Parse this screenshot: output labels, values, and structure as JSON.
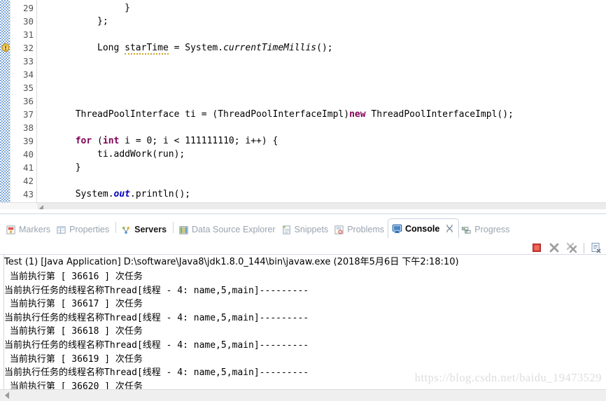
{
  "editor": {
    "name": "java-code-editor",
    "marker_icon": "warning-icon",
    "marker_line": 32,
    "lines": [
      {
        "no": "29",
        "indent": 16,
        "tokens": [
          {
            "t": "}",
            "c": "plain"
          }
        ]
      },
      {
        "no": "30",
        "indent": 11,
        "tokens": [
          {
            "t": "};",
            "c": "plain"
          }
        ]
      },
      {
        "no": "31",
        "indent": 0,
        "tokens": []
      },
      {
        "no": "32",
        "indent": 11,
        "tokens": [
          {
            "t": "Long ",
            "c": "plain"
          },
          {
            "t": "starTime",
            "c": "warn"
          },
          {
            "t": " = System.",
            "c": "plain"
          },
          {
            "t": "currentTimeMillis",
            "c": "method"
          },
          {
            "t": "();",
            "c": "plain"
          }
        ]
      },
      {
        "no": "33",
        "indent": 0,
        "tokens": []
      },
      {
        "no": "34",
        "indent": 0,
        "tokens": []
      },
      {
        "no": "35",
        "indent": 0,
        "tokens": []
      },
      {
        "no": "36",
        "indent": 0,
        "tokens": []
      },
      {
        "no": "37",
        "indent": 7,
        "tokens": [
          {
            "t": "ThreadPoolInterface ti = (ThreadPoolInterfaceImpl)",
            "c": "plain"
          },
          {
            "t": "new",
            "c": "keyword"
          },
          {
            "t": " ThreadPoolInterfaceImpl();",
            "c": "plain"
          }
        ]
      },
      {
        "no": "38",
        "indent": 0,
        "tokens": []
      },
      {
        "no": "39",
        "indent": 7,
        "tokens": [
          {
            "t": "for",
            "c": "keyword"
          },
          {
            "t": " (",
            "c": "plain"
          },
          {
            "t": "int",
            "c": "keyword"
          },
          {
            "t": " i = 0; i < 111111110; i++) {",
            "c": "plain"
          }
        ]
      },
      {
        "no": "40",
        "indent": 11,
        "tokens": [
          {
            "t": "ti.addWork(run);",
            "c": "plain"
          }
        ]
      },
      {
        "no": "41",
        "indent": 7,
        "tokens": [
          {
            "t": "}",
            "c": "plain"
          }
        ]
      },
      {
        "no": "42",
        "indent": 0,
        "tokens": []
      },
      {
        "no": "43",
        "indent": 7,
        "tokens": [
          {
            "t": "System.",
            "c": "plain"
          },
          {
            "t": "out",
            "c": "field"
          },
          {
            "t": ".println();",
            "c": "plain"
          }
        ]
      }
    ]
  },
  "view_tabs": [
    {
      "label": "Markers",
      "icon": "markers-icon",
      "state": "inactive"
    },
    {
      "label": "Properties",
      "icon": "properties-icon",
      "state": "inactive"
    },
    {
      "label": "Servers",
      "icon": "servers-icon",
      "state": "selected-bold"
    },
    {
      "label": "Data Source Explorer",
      "icon": "data-source-explorer-icon",
      "state": "inactive"
    },
    {
      "label": "Snippets",
      "icon": "snippets-icon",
      "state": "inactive"
    },
    {
      "label": "Problems",
      "icon": "problems-icon",
      "state": "inactive"
    },
    {
      "label": "Console",
      "icon": "console-icon",
      "state": "active",
      "closable": true
    },
    {
      "label": "Progress",
      "icon": "progress-icon",
      "state": "inactive"
    }
  ],
  "console_toolbar": [
    {
      "name": "terminate-button",
      "icon": "stop-square-icon",
      "color": "#e03b32"
    },
    {
      "name": "remove-launch-button",
      "icon": "x-icon",
      "color": "#9e9e9e"
    },
    {
      "name": "remove-all-terminated-button",
      "icon": "double-x-icon",
      "color": "#9e9e9e"
    },
    {
      "name": "clear-console-button",
      "icon": "clear-document-icon",
      "color": "#7a93b5"
    }
  ],
  "console": {
    "header": "Test (1) [Java Application] D:\\software\\Java8\\jdk1.8.0_144\\bin\\javaw.exe (2018年5月6日 下午2:18:10)",
    "lines": [
      " 当前执行第 [ 36616 ] 次任务",
      "当前执行任务的线程名称Thread[线程 - 4: name,5,main]---------",
      " 当前执行第 [ 36617 ] 次任务",
      "当前执行任务的线程名称Thread[线程 - 4: name,5,main]---------",
      " 当前执行第 [ 36618 ] 次任务",
      "当前执行任务的线程名称Thread[线程 - 4: name,5,main]---------",
      " 当前执行第 [ 36619 ] 次任务",
      "当前执行任务的线程名称Thread[线程 - 4: name,5,main]---------",
      " 当前执行第 [ 36620 ] 次任务"
    ]
  },
  "watermark": "https://blog.csdn.net/baidu_19473529",
  "colors": {
    "keyword": "#7f0055",
    "field": "#0000c0",
    "warning_underline": "#c9a227",
    "annotation_bar": "#7da7d9",
    "stop_red": "#e03b32"
  }
}
